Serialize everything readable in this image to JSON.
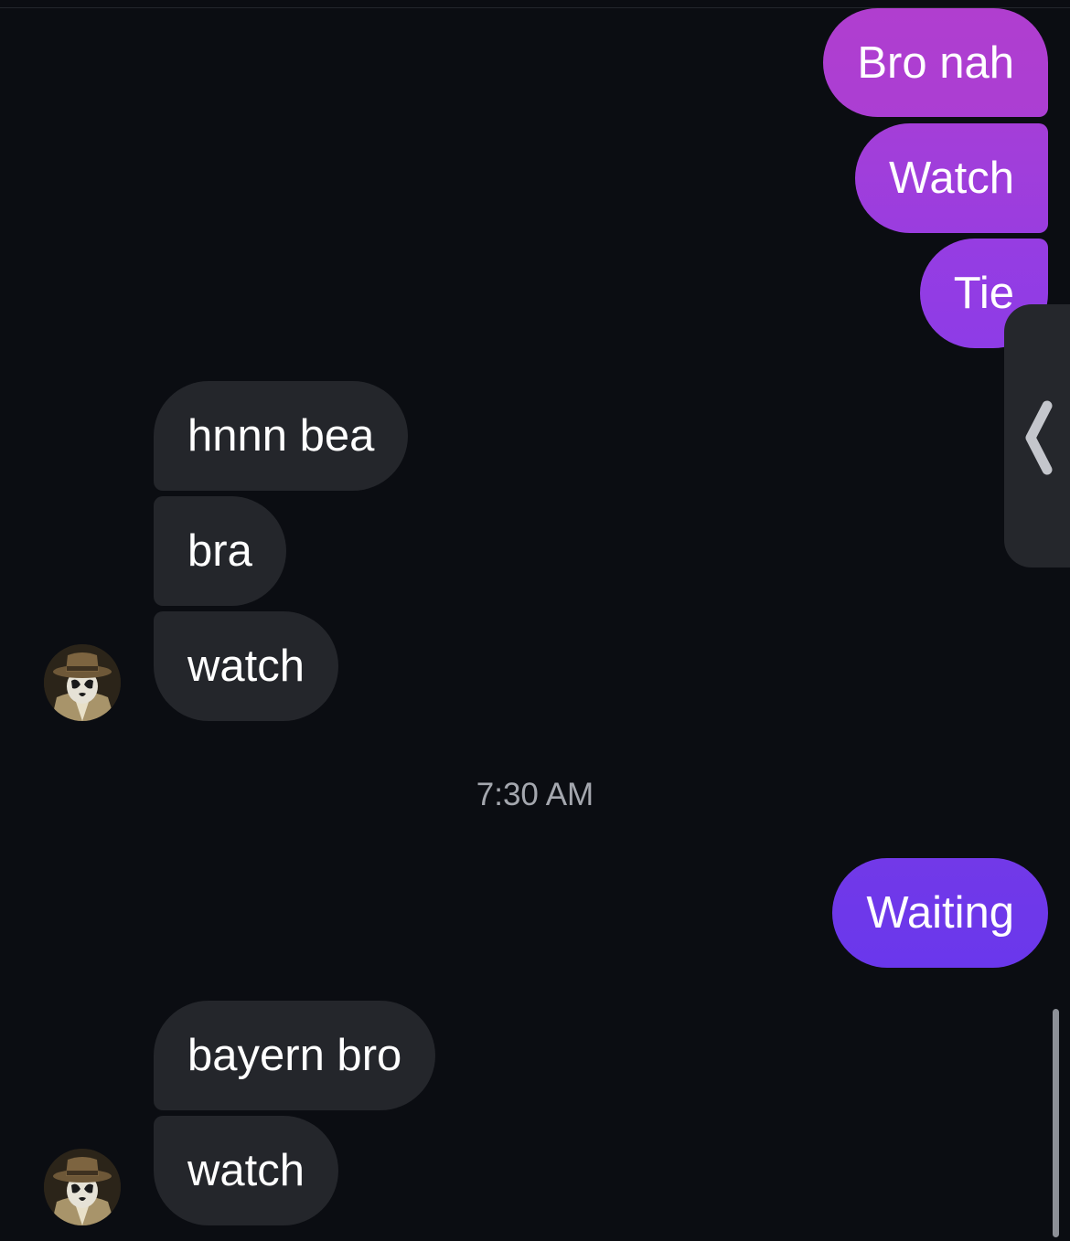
{
  "conversation": {
    "messages": [
      {
        "direction": "sent",
        "text": "Bro nah"
      },
      {
        "direction": "sent",
        "text": "Watch"
      },
      {
        "direction": "sent",
        "text": "Tie"
      },
      {
        "direction": "received",
        "text": "hnnn bea"
      },
      {
        "direction": "received",
        "text": "bra"
      },
      {
        "direction": "received",
        "text": "watch"
      },
      {
        "direction": "sent",
        "text": "Waiting"
      },
      {
        "direction": "received",
        "text": "bayern bro"
      },
      {
        "direction": "received",
        "text": "watch"
      }
    ],
    "timestamp": "7:30 AM"
  },
  "contact": {
    "avatar_icon": "hooded-masked-figure-avatar"
  },
  "colors": {
    "background": "#0b0d12",
    "received_bubble": "#24262b",
    "sent_gradient_top": "#b03ed0",
    "sent_gradient_bottom": "#6a38ea",
    "timestamp_text": "#a4a7ae"
  },
  "icons": {
    "side_panel_toggle": "chevron-left-icon"
  }
}
